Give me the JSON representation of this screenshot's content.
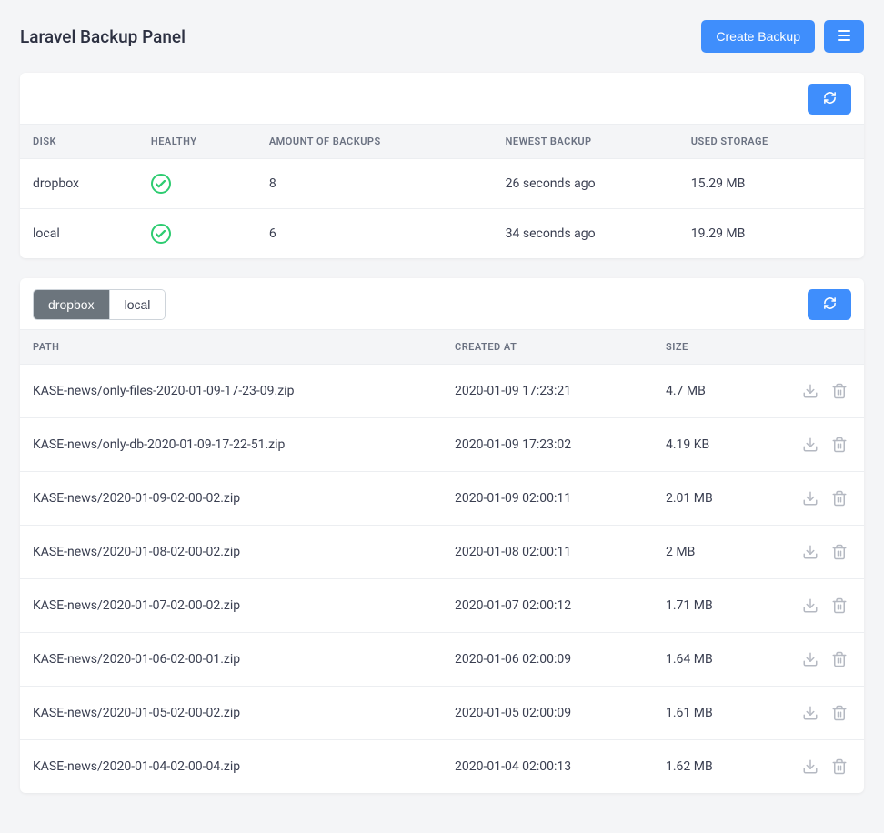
{
  "header": {
    "title": "Laravel Backup Panel",
    "create_button": "Create Backup"
  },
  "disks_table": {
    "headers": {
      "disk": "Disk",
      "healthy": "Healthy",
      "amount": "Amount of backups",
      "newest": "Newest backup",
      "used": "Used storage"
    },
    "rows": [
      {
        "disk": "dropbox",
        "healthy": true,
        "amount": "8",
        "newest": "26 seconds ago",
        "used": "15.29 MB"
      },
      {
        "disk": "local",
        "healthy": true,
        "amount": "6",
        "newest": "34 seconds ago",
        "used": "19.29 MB"
      }
    ]
  },
  "tabs": [
    "dropbox",
    "local"
  ],
  "active_tab": "dropbox",
  "backups_table": {
    "headers": {
      "path": "Path",
      "created": "Created At",
      "size": "Size"
    },
    "rows": [
      {
        "path": "KASE-news/only-files-2020-01-09-17-23-09.zip",
        "created": "2020-01-09 17:23:21",
        "size": "4.7 MB"
      },
      {
        "path": "KASE-news/only-db-2020-01-09-17-22-51.zip",
        "created": "2020-01-09 17:23:02",
        "size": "4.19 KB"
      },
      {
        "path": "KASE-news/2020-01-09-02-00-02.zip",
        "created": "2020-01-09 02:00:11",
        "size": "2.01 MB"
      },
      {
        "path": "KASE-news/2020-01-08-02-00-02.zip",
        "created": "2020-01-08 02:00:11",
        "size": "2 MB"
      },
      {
        "path": "KASE-news/2020-01-07-02-00-02.zip",
        "created": "2020-01-07 02:00:12",
        "size": "1.71 MB"
      },
      {
        "path": "KASE-news/2020-01-06-02-00-01.zip",
        "created": "2020-01-06 02:00:09",
        "size": "1.64 MB"
      },
      {
        "path": "KASE-news/2020-01-05-02-00-02.zip",
        "created": "2020-01-05 02:00:09",
        "size": "1.61 MB"
      },
      {
        "path": "KASE-news/2020-01-04-02-00-04.zip",
        "created": "2020-01-04 02:00:13",
        "size": "1.62 MB"
      }
    ]
  }
}
